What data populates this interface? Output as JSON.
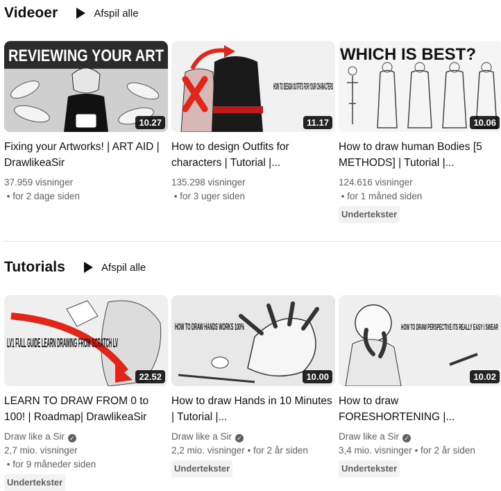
{
  "shelves": [
    {
      "title": "Videoer",
      "play_all": "Afspil alle",
      "videos": [
        {
          "title": "Fixing your Artworks! | ART AID | DrawlikeaSir",
          "duration": "10.27",
          "channel": "",
          "views": "37.959 visninger",
          "age": "for 2 dage siden",
          "badge": "",
          "thumb_text": "REVIEWING YOUR ART"
        },
        {
          "title": "How to design Outfits for characters | Tutorial |...",
          "duration": "11.17",
          "channel": "",
          "views": "135.298 visninger",
          "age": "for 3 uger siden",
          "badge": "",
          "thumb_text": "HOW TO DESIGN OUTFITS FOR YOUR CHARACTERS"
        },
        {
          "title": "How to draw human Bodies [5 METHODS] | Tutorial |...",
          "duration": "10.06",
          "channel": "",
          "views": "124.616 visninger",
          "age": "for 1 måned siden",
          "badge": "Undertekster",
          "thumb_text": "WHICH IS BEST?"
        }
      ]
    },
    {
      "title": "Tutorials",
      "play_all": "Afspil alle",
      "videos": [
        {
          "title": "LEARN TO DRAW FROM 0 to 100! | Roadmap| DrawlikeaSir",
          "duration": "22.52",
          "channel": "Draw like a Sir",
          "views": "2,7 mio. visninger",
          "age": "for 9 måneder siden",
          "badge": "Undertekster",
          "thumb_text": "LV1 FULL GUIDE LEARN DRAWING FROM SCRATCH LV"
        },
        {
          "title": "How to draw Hands in 10 Minutes | Tutorial |...",
          "duration": "10.00",
          "channel": "Draw like a Sir",
          "views": "2,2 mio. visninger",
          "age": "for 2 år siden",
          "badge": "Undertekster",
          "thumb_text": "HOW TO DRAW HANDS WORKS 100%"
        },
        {
          "title": "How to draw FORESHORTENING |...",
          "duration": "10.02",
          "channel": "Draw like a Sir",
          "views": "3,4 mio. visninger",
          "age": "for 2 år siden",
          "badge": "Undertekster",
          "thumb_text": "HOW TO DRAW PERSPECTIVE ITS REALLY EASY I SWEAR"
        }
      ]
    }
  ],
  "colors": {
    "duration_bg": "#000000",
    "meta": "#606060",
    "badge_bg": "#f2f2f2",
    "accent_red": "#e0251b"
  },
  "icons": {
    "play_all": "play-triangle-icon",
    "verified": "verified-check-icon"
  }
}
